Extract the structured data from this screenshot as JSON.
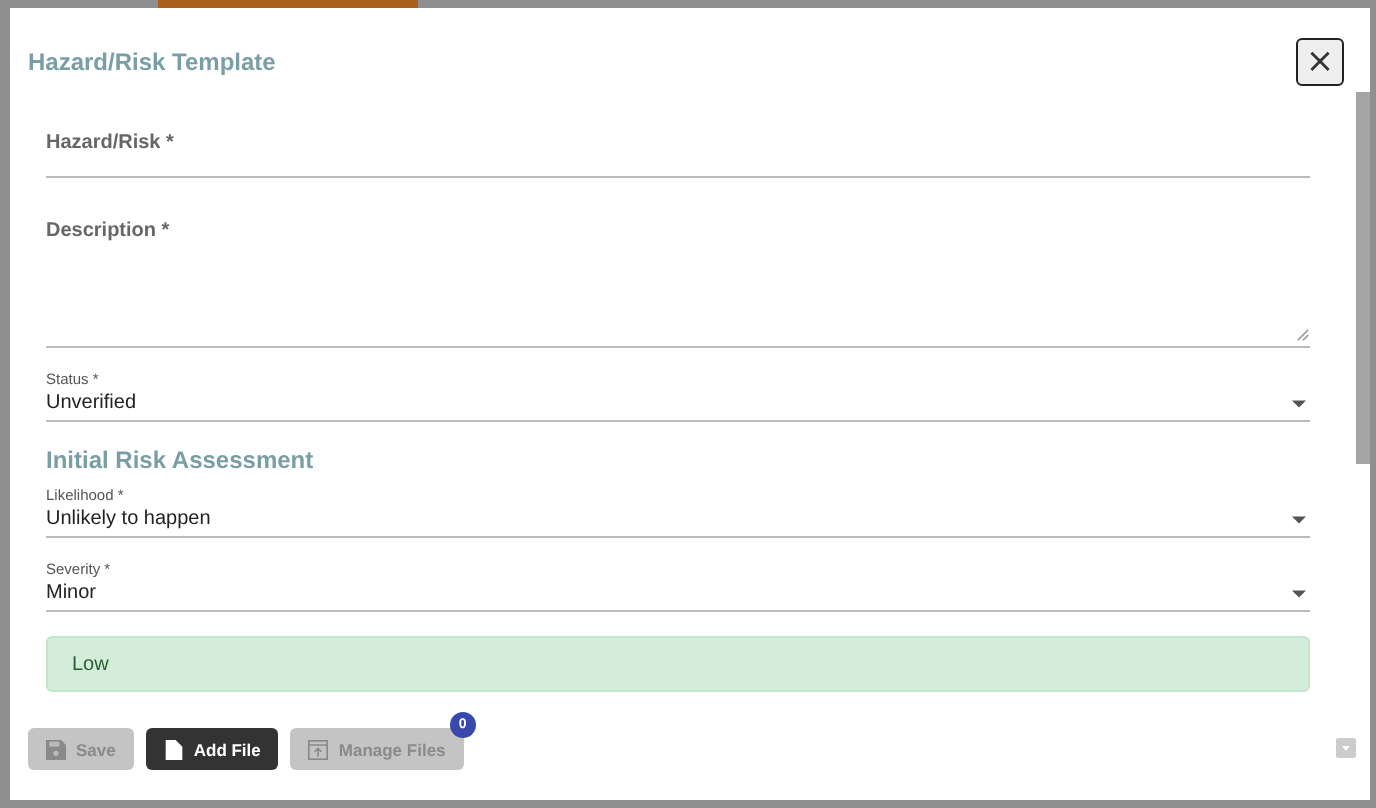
{
  "dialog": {
    "title": "Hazard/Risk Template",
    "close_label": "×"
  },
  "text_fields": [
    {
      "label": "Hazard/Risk *",
      "kind": "input"
    },
    {
      "label": "Description *",
      "kind": "textarea"
    }
  ],
  "status": {
    "label": "Status *",
    "value": "Unverified"
  },
  "section_title": "Initial Risk Assessment",
  "selects": [
    {
      "label": "Likelihood *",
      "value": "Unlikely to happen"
    },
    {
      "label": "Severity *",
      "value": "Minor"
    }
  ],
  "risk_level": {
    "text": "Low",
    "color": "#d4edda"
  },
  "buttons": [
    {
      "label": "Save",
      "kind": "save",
      "disabled": true
    },
    {
      "label": "Add File",
      "kind": "file",
      "disabled": false
    },
    {
      "label": "Manage Files",
      "kind": "manage",
      "disabled": true,
      "badge": "0"
    }
  ]
}
